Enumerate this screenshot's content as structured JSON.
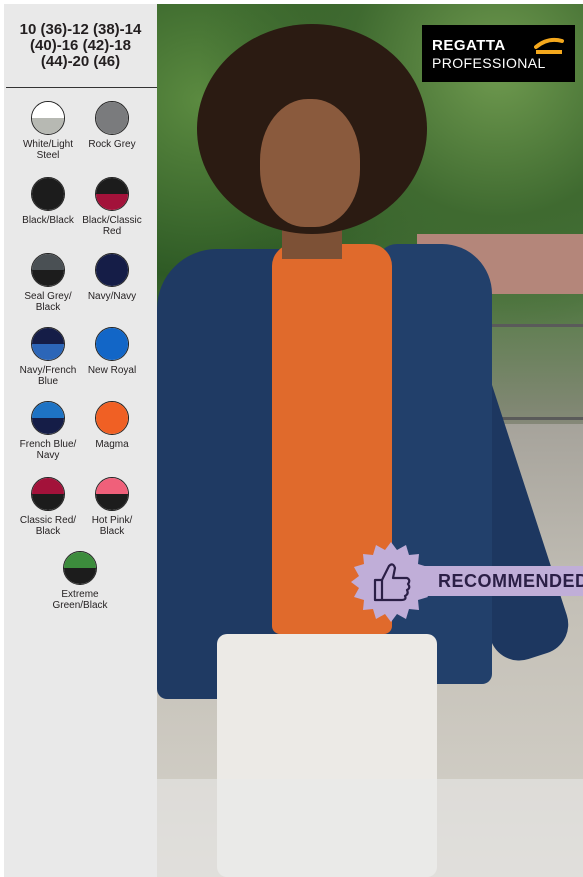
{
  "sizes": "10 (36)-12 (38)-14 (40)-16 (42)-18 (44)-20 (46)",
  "colours": [
    {
      "label": "White/Light Steel",
      "top": "#ffffff",
      "bottom": "#b7b9b3"
    },
    {
      "label": "Rock Grey",
      "top": "#7a7b7d",
      "bottom": "#7a7b7d"
    },
    {
      "label": "Black/Black",
      "top": "#1c1c1c",
      "bottom": "#1c1c1c"
    },
    {
      "label": "Black/Classic Red",
      "top": "#1c1c1c",
      "bottom": "#a3123a"
    },
    {
      "label": "Seal Grey/ Black",
      "top": "#4a5054",
      "bottom": "#1c1c1c"
    },
    {
      "label": "Navy/Navy",
      "top": "#151d47",
      "bottom": "#151d47"
    },
    {
      "label": "Navy/French Blue",
      "top": "#151d47",
      "bottom": "#2c66b8"
    },
    {
      "label": "New Royal",
      "top": "#1266c7",
      "bottom": "#1266c7"
    },
    {
      "label": "French Blue/ Navy",
      "top": "#1e73c4",
      "bottom": "#151d47"
    },
    {
      "label": "Magma",
      "top": "#f06024",
      "bottom": "#f06024"
    },
    {
      "label": "Classic Red/ Black",
      "top": "#a3123a",
      "bottom": "#1c1c1c"
    },
    {
      "label": "Hot Pink/ Black",
      "top": "#f0607a",
      "bottom": "#1c1c1c"
    },
    {
      "label": "Extreme Green/Black",
      "top": "#3c8c3c",
      "bottom": "#1c1c1c"
    }
  ],
  "logo": {
    "brand": "REGATTA",
    "line2": "PROFESSIONAL"
  },
  "badge": {
    "text": "RECOMMENDED",
    "icon": "thumbs-up-icon",
    "color": "#c0aed8"
  }
}
